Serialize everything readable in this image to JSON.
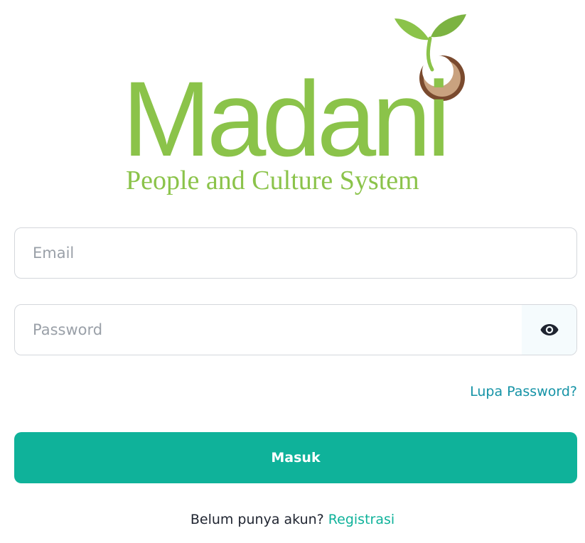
{
  "logo": {
    "wordmark": "Madani",
    "tagline": "People and Culture System",
    "color": "#8bc34a",
    "icon": "sprout-seed-icon"
  },
  "form": {
    "email": {
      "placeholder": "Email",
      "value": ""
    },
    "password": {
      "placeholder": "Password",
      "value": "",
      "toggle_icon": "eye-icon"
    },
    "forgot_password_label": "Lupa Password?",
    "submit_label": "Masuk",
    "register_prompt": "Belum punya akun?",
    "register_link_label": "Registrasi"
  },
  "colors": {
    "primary": "#0fb29a",
    "link": "#1593a6",
    "brand_green": "#8bc34a",
    "seed_brown": "#8a5a3b"
  }
}
